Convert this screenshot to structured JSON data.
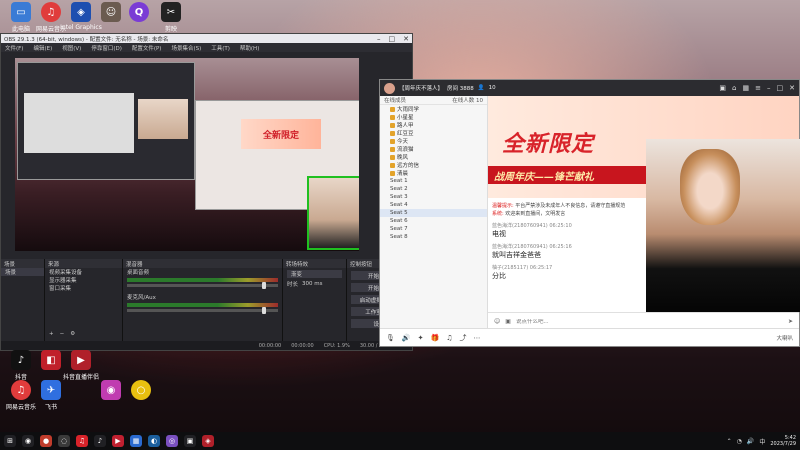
{
  "desktop": {
    "top_icons": [
      {
        "label": "此电脑",
        "color": "#3a7bd5",
        "glyph": "▭"
      },
      {
        "label": "网易云音乐",
        "color": "#e03c3c",
        "glyph": "♫"
      },
      {
        "label": "Intel Graphics",
        "color": "#1e4fb0",
        "glyph": "◈"
      },
      {
        "label": "",
        "color": "#6b5b50",
        "glyph": "☺"
      },
      {
        "label": "Q",
        "color": "#7a3cd5",
        "glyph": "Q"
      },
      {
        "label": "剪映",
        "color": "#222222",
        "glyph": "✂"
      }
    ],
    "bottom_icons": [
      {
        "label": "抖音",
        "color": "#111111",
        "glyph": "♪"
      },
      {
        "label": "抖音",
        "color": "#c0202a",
        "glyph": "◧"
      },
      {
        "label": "抖音直播伴侣",
        "color": "#b0202a",
        "glyph": "▶"
      },
      {
        "label": "网易云音乐",
        "color": "#e03c3c",
        "glyph": "♫"
      },
      {
        "label": "飞书",
        "color": "#2f6fe0",
        "glyph": "✈"
      },
      {
        "label": "",
        "color": "#c03cb0",
        "glyph": "◉"
      },
      {
        "label": "",
        "color": "#e8c010",
        "glyph": "○"
      }
    ]
  },
  "obs": {
    "title": "OBS 29.1.3 (64-bit, windows) - 配置文件: 无名称 - 场景: 未命名",
    "menu": [
      "文件(F)",
      "编辑(E)",
      "视图(V)",
      "停靠窗口(D)",
      "配置文件(P)",
      "场景集合(S)",
      "工具(T)",
      "帮助(H)"
    ],
    "preview_banner": "全新限定",
    "docks": {
      "scenes": {
        "header": "场景",
        "items": [
          "场景"
        ]
      },
      "sources": {
        "header": "来源",
        "items": [
          "视频采集设备",
          "显示器采集",
          "窗口采集"
        ]
      },
      "mixer": {
        "header": "混音器",
        "tracks": [
          "桌面音频",
          "麦克风/Aux"
        ]
      },
      "transitions": {
        "header": "转场特效",
        "value": "渐变",
        "duration_label": "时长",
        "duration": "300 ms"
      },
      "controls": {
        "header": "控制按钮",
        "buttons": [
          "开始直播",
          "开始录制",
          "启动虚拟摄像机",
          "工作室模式",
          "设置",
          "退出"
        ]
      }
    },
    "status": {
      "time1": "00:00:00",
      "time2": "00:00:00",
      "cpu": "CPU: 1.9%",
      "fps": "30.00 / 30.00 FPS"
    }
  },
  "live": {
    "room_title": "【周年庆不落人】",
    "room_id": "房间 3888",
    "viewer_count": "10",
    "room_list": {
      "header": "在线成员",
      "online_count": "在线人数 10",
      "members": [
        "大雨同学",
        "小星星",
        "路人甲",
        "红豆豆",
        "今天",
        "流浪猫",
        "晚风",
        "远方的信",
        "清晨"
      ],
      "groups": [
        "Seat 1",
        "Seat 2",
        "Seat 3",
        "Seat 4",
        "Seat 5",
        "Seat 6",
        "Seat 7",
        "Seat 8"
      ]
    },
    "stage": {
      "headline": "全新限定",
      "subline": "战周年庆——锋芒献礼"
    },
    "chat": {
      "notices": [
        {
          "label": "温馨提示:",
          "text": "平台严禁涉及未成年人不良信息，请遵守直播规范"
        },
        {
          "label": "系统:",
          "text": "欢迎来到直播间，文明发言"
        }
      ],
      "messages": [
        {
          "user": "蓝色海洋(2180760941)",
          "time": "06:25:10",
          "text": "电视"
        },
        {
          "user": "蓝色海洋(2180760941)",
          "time": "06:25:16",
          "text": "就叫吉祥金爸爸"
        },
        {
          "user": "柚子(2185117)",
          "time": "06:25:17",
          "text": "分比"
        }
      ],
      "input_placeholder": "说点什么吧..."
    },
    "bottom": {
      "right_text": "大喇叭"
    }
  },
  "taskbar": {
    "time": "5:42",
    "date": "2023/7/29",
    "items": [
      {
        "glyph": "◉",
        "color": "#202024"
      },
      {
        "glyph": "●",
        "color": "#c03c2c"
      },
      {
        "glyph": "◌",
        "color": "#3a3a3a"
      },
      {
        "glyph": "♫",
        "color": "#d8232a"
      },
      {
        "glyph": "♪",
        "color": "#202024"
      },
      {
        "glyph": "▶",
        "color": "#c02030"
      },
      {
        "glyph": "▦",
        "color": "#2a6ad0"
      },
      {
        "glyph": "◐",
        "color": "#1b5f9e"
      },
      {
        "glyph": "◎",
        "color": "#7a50c0"
      },
      {
        "glyph": "▣",
        "color": "#202024"
      },
      {
        "glyph": "◈",
        "color": "#b0202a"
      }
    ]
  }
}
